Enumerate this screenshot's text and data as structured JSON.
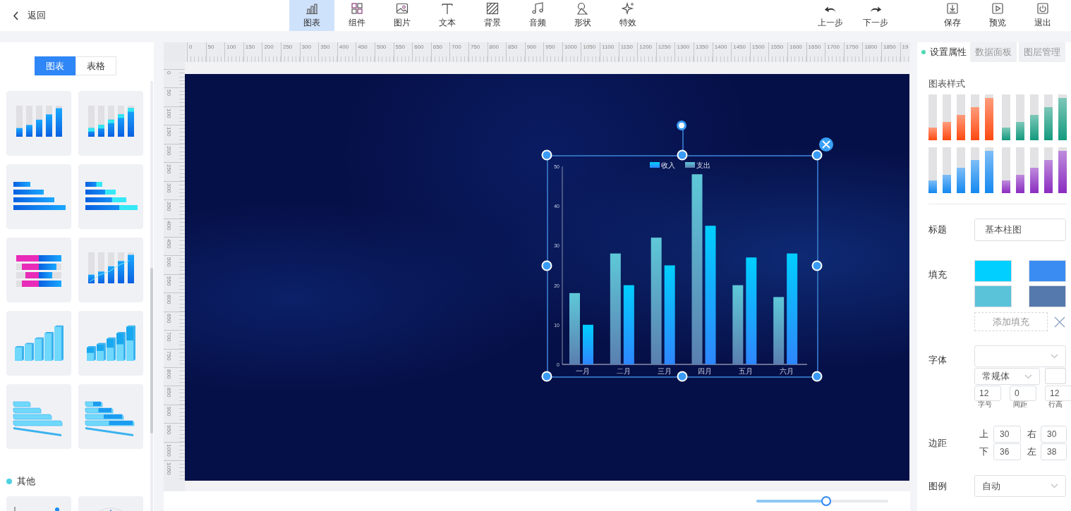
{
  "toolbar": {
    "back": {
      "label": "返回"
    },
    "tools": [
      {
        "label": "图表",
        "selected": true
      },
      {
        "label": "组件",
        "selected": false
      },
      {
        "label": "图片",
        "selected": false
      },
      {
        "label": "文本",
        "selected": false
      },
      {
        "label": "背景",
        "selected": false
      },
      {
        "label": "音频",
        "selected": false
      },
      {
        "label": "形状",
        "selected": false
      },
      {
        "label": "特效",
        "selected": false
      }
    ],
    "history": [
      {
        "label": "上一步"
      },
      {
        "label": "下一步"
      }
    ],
    "actions": [
      {
        "label": "保存"
      },
      {
        "label": "预览"
      },
      {
        "label": "退出"
      }
    ]
  },
  "left_panel": {
    "tabs": [
      {
        "label": "图表",
        "selected": true
      },
      {
        "label": "表格",
        "selected": false
      }
    ],
    "sections": [
      {
        "thumbnails": [
          {
            "kind": "bar"
          },
          {
            "kind": "bar-stacked"
          },
          {
            "kind": "hbar"
          },
          {
            "kind": "hbar-stacked"
          },
          {
            "kind": "butterfly"
          },
          {
            "kind": "bar-line"
          },
          {
            "kind": "bar-3d"
          },
          {
            "kind": "bar-3d-stacked"
          },
          {
            "kind": "hbar-3d"
          },
          {
            "kind": "hbar-3d-stacked"
          }
        ]
      },
      {
        "title": "其他",
        "thumbnails": [
          {
            "kind": "scatter"
          },
          {
            "kind": "radar"
          }
        ]
      }
    ]
  },
  "ruler": {
    "horizontal": [
      "0",
      "50",
      "100",
      "150",
      "200",
      "250",
      "300",
      "350",
      "400",
      "450",
      "500",
      "550",
      "600",
      "650",
      "700",
      "750",
      "800",
      "850",
      "900",
      "950",
      "1000",
      "1050",
      "1100",
      "1150",
      "1200",
      "1250",
      "1300",
      "1350",
      "1400",
      "1450",
      "1500",
      "1550",
      "1600",
      "1650",
      "1700",
      "1750",
      "1800",
      "1850",
      "19"
    ],
    "vertical": [
      "0",
      "50",
      "100",
      "150",
      "200",
      "250",
      "300",
      "350",
      "400",
      "450",
      "500",
      "550",
      "600",
      "650",
      "700",
      "750",
      "800",
      "850",
      "900",
      "950",
      "1000",
      "1050"
    ]
  },
  "canvas": {
    "chart": {
      "chart_data": {
        "type": "bar",
        "categories": [
          "一月",
          "二月",
          "三月",
          "四月",
          "五月",
          "六月"
        ],
        "series": [
          {
            "name": "收入",
            "color": "#00cfff",
            "values": [
              10,
              20,
              25,
              35,
              27,
              28
            ]
          },
          {
            "name": "支出",
            "color": "#5ec8d8",
            "values": [
              18,
              28,
              32,
              48,
              20,
              17
            ]
          }
        ],
        "ylim": [
          0,
          50
        ],
        "yticks": [
          0,
          10,
          20,
          30,
          40,
          50
        ],
        "legend": true
      }
    }
  },
  "zoom_slider": {
    "level": 0.53
  },
  "right_panel": {
    "tabs": [
      {
        "label": "设置属性",
        "selected": true
      },
      {
        "label": "数据面板",
        "selected": false
      },
      {
        "label": "图层管理",
        "selected": false
      }
    ],
    "style_heading": "图表样式",
    "palettes": [
      {
        "color": "#ff4a10"
      },
      {
        "color": "#139a7e"
      },
      {
        "color": "#1488f0"
      },
      {
        "color": "#8a2cc0"
      }
    ],
    "title_field": {
      "label": "标题",
      "value": "基本柱图"
    },
    "fill": {
      "label": "填充",
      "swatches": [
        {
          "color": "#00cfff"
        },
        {
          "color": "#3a8cf2"
        },
        {
          "color": "#5bc3d9"
        },
        {
          "color": "#5578ad"
        }
      ],
      "add_button": "添加填充"
    },
    "font": {
      "label": "字体",
      "weight": "常规体",
      "size": {
        "value": "12",
        "caption": "字号"
      },
      "spacing": {
        "value": "0",
        "caption": "间距"
      },
      "line_height": {
        "value": "12",
        "caption": "行高"
      }
    },
    "margin": {
      "label": "边距",
      "top": {
        "label": "上",
        "value": "30"
      },
      "right": {
        "label": "右",
        "value": "30"
      },
      "bottom": {
        "label": "下",
        "value": "36"
      },
      "left": {
        "label": "左",
        "value": "38"
      }
    },
    "legend": {
      "label": "图例",
      "value": "自动"
    }
  }
}
